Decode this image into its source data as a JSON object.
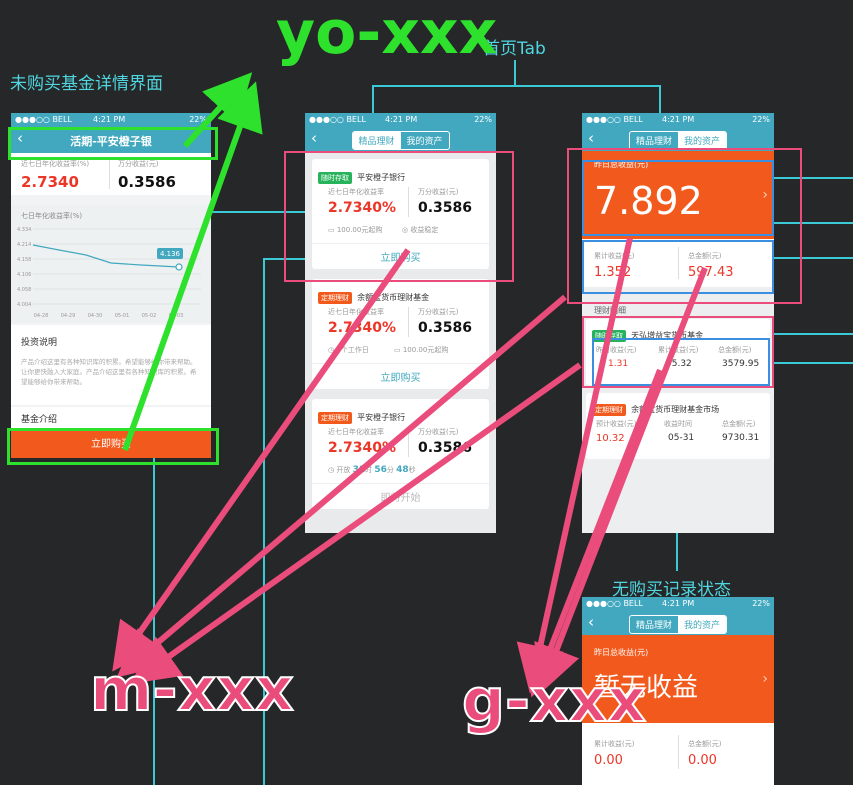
{
  "labels": {
    "yo_xxx": "yo-xxx",
    "m_xxx": "m-xxx",
    "g_xxx": "g-xxx",
    "home_tab": "首页Tab",
    "unpurchased_detail": "未购买基金详情界面",
    "no_record": "无购买记录状态"
  },
  "status_bar": {
    "carrier": "●●●○○ BELL",
    "time": "4:21 PM",
    "battery": "22%"
  },
  "segment": {
    "tab1": "精品理财",
    "tab2": "我的资产"
  },
  "screen1": {
    "title": "活期-平安橙子银",
    "rate_label": "近七日年化收益率(%)",
    "rate_value": "2.7340",
    "wan_label": "万分收益(元)",
    "wan_value": "0.3586",
    "chart_title": "七日年化收益率(%)",
    "y_ticks": [
      "4.334",
      "4.214",
      "4.158",
      "4.106",
      "4.058",
      "4.004"
    ],
    "x_ticks": [
      "04-28",
      "04-29",
      "04-30",
      "05-01",
      "05-02",
      "05-03"
    ],
    "point_label": "4.136",
    "invest_title": "投资说明",
    "invest_text1": "产品介绍这里有各种知识库的积累。希望能够给你带来帮助。让你更快融入大家庭。产品介绍这里有各种知识库的积累。希望能够给你带来帮助。",
    "fund_intro": "基金介绍",
    "buy": "立即购买"
  },
  "screen2": {
    "card1": {
      "tag": "随时存取",
      "name": "平安橙子银行",
      "rate_label": "近七日年化收益率",
      "rate": "2.7340%",
      "wan_label": "万分收益(元)",
      "wan": "0.3586",
      "min": "100.00元起购",
      "stable": "收益稳定",
      "action": "立即购买"
    },
    "card2": {
      "tag": "定期理财",
      "name": "余额宝货币理财基金",
      "rate_label": "近七日年化收益率",
      "rate": "2.7340%",
      "wan_label": "万分收益(元)",
      "wan": "0.3586",
      "days": "6个工作日",
      "min": "100.00元起购",
      "action": "立即购买"
    },
    "card3": {
      "tag": "定期理财",
      "name": "平安橙子银行",
      "rate_label": "近七日年化收益率",
      "rate": "2.7340%",
      "wan_label": "万分收益(元)",
      "wan": "0.3586",
      "count_pre": "开放",
      "hours": "31",
      "hours_unit": "时",
      "minutes": "56",
      "minutes_unit": "分",
      "seconds": "48",
      "seconds_unit": "秒",
      "action": "即将开始"
    }
  },
  "screen3": {
    "yesterday_label": "昨日总收益(元)",
    "yesterday_value": "7.892",
    "cum_label": "累计收益(元)",
    "cum_value": "1.352",
    "total_label": "总金额(元)",
    "total_value": "597.43",
    "detail_title": "理财明细",
    "item1": {
      "tag": "随时存取",
      "name": "天弘增益宝货币基金",
      "c1_label": "昨日收益(元)",
      "c1": "1.31",
      "c2_label": "累计收益(元)",
      "c2": "55.32",
      "c3_label": "总金额(元)",
      "c3": "3579.95"
    },
    "item2": {
      "tag": "定期理财",
      "name": "余额宝货币理财基金市场",
      "c1_label": "预计收益(元)",
      "c1": "10.32",
      "c2_label": "收益时间",
      "c2": "05-31",
      "c3_label": "总金额(元)",
      "c3": "9730.31"
    }
  },
  "screen4": {
    "yesterday_label": "昨日总收益(元)",
    "empty_text": "暂无收益",
    "cum_label": "累计收益(元)",
    "cum_value": "0.00",
    "total_label": "总金额(元)",
    "total_value": "0.00"
  },
  "colors": {
    "teal": "#41a8bf",
    "orange": "#f25a1d",
    "pink": "#ea4c7c",
    "green": "#2de12d",
    "blue": "#3c8ee0",
    "cyan": "#3cc9d6"
  }
}
